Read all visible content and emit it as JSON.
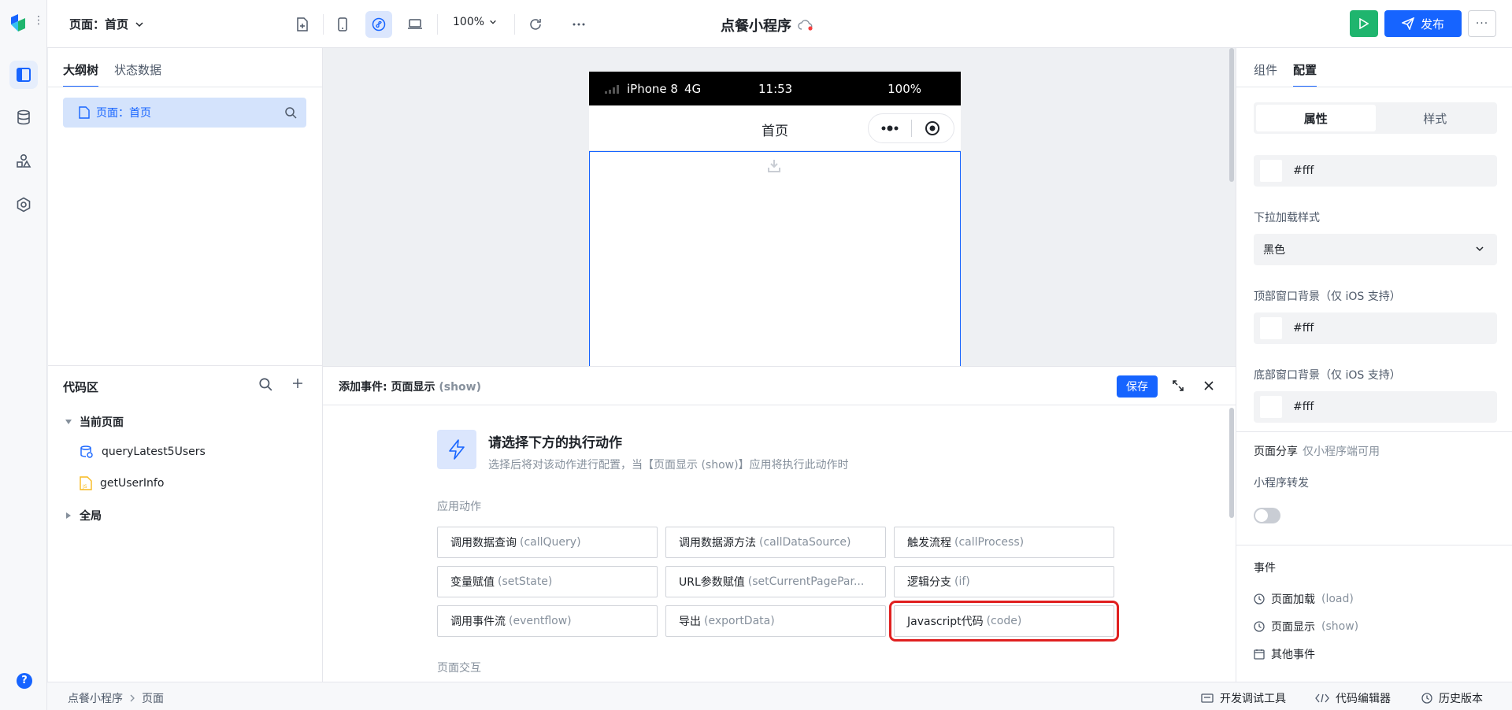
{
  "topbar": {
    "page_select": "页面：首页",
    "zoom": "100%",
    "app_title": "点餐小程序",
    "publish": "发布"
  },
  "left_panel": {
    "tabs": [
      "大纲树",
      "状态数据"
    ],
    "tree_item": "页面：首页",
    "code_area": {
      "title": "代码区",
      "current_page": "当前页面",
      "items": [
        "queryLatest5Users",
        "getUserInfo"
      ],
      "global": "全局"
    }
  },
  "phone": {
    "carrier": "iPhone 8",
    "network": "4G",
    "time": "11:53",
    "battery": "100%",
    "nav_title": "首页"
  },
  "editor": {
    "title": "添加事件: 页面显示",
    "title_code": "(show)",
    "save": "保存",
    "hint_title": "请选择下方的执行动作",
    "hint_sub": "选择后将对该动作进行配置，当【页面显示 (show)】应用将执行此动作时",
    "section_app": "应用动作",
    "section_page": "页面交互",
    "actions": [
      {
        "label": "调用数据查询",
        "code": "(callQuery)"
      },
      {
        "label": "调用数据源方法",
        "code": "(callDataSource)"
      },
      {
        "label": "触发流程",
        "code": "(callProcess)"
      },
      {
        "label": "变量赋值",
        "code": "(setState)"
      },
      {
        "label": "URL参数赋值",
        "code": "(setCurrentPagePar..."
      },
      {
        "label": "逻辑分支",
        "code": "(if)"
      },
      {
        "label": "调用事件流",
        "code": "(eventflow)"
      },
      {
        "label": "导出",
        "code": "(exportData)"
      },
      {
        "label": "Javascript代码",
        "code": "(code)"
      }
    ]
  },
  "right_panel": {
    "tabs": [
      "组件",
      "配置"
    ],
    "seg": [
      "属性",
      "样式"
    ],
    "color1": "#fff",
    "pull_style_label": "下拉加载样式",
    "pull_style_value": "黑色",
    "top_bg_label": "顶部窗口背景（仅 iOS 支持）",
    "top_bg_value": "#fff",
    "bottom_bg_label": "底部窗口背景（仅 iOS 支持）",
    "bottom_bg_value": "#fff",
    "share_title": "页面分享",
    "share_note": "仅小程序端可用",
    "forward_label": "小程序转发",
    "events_title": "事件",
    "events": [
      {
        "label": "页面加载",
        "code": "(load)"
      },
      {
        "label": "页面显示",
        "code": "(show)"
      },
      {
        "label": "其他事件",
        "code": ""
      }
    ]
  },
  "bottombar": {
    "breadcrumb": [
      "点餐小程序",
      "页面"
    ],
    "debug": "开发调试工具",
    "code_editor": "代码编辑器",
    "history": "历史版本"
  },
  "colors": {
    "accent": "#1664ff",
    "run": "#1fb56e",
    "highlight": "#e02020"
  }
}
